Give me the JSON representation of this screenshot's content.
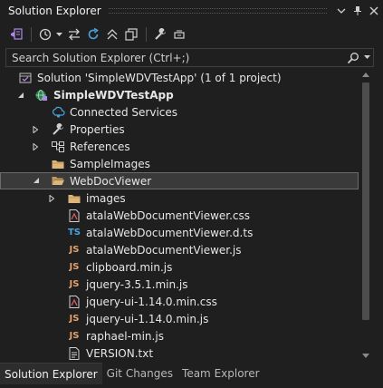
{
  "panel": {
    "title": "Solution Explorer"
  },
  "search": {
    "placeholder": "Search Solution Explorer (Ctrl+;)"
  },
  "tree": {
    "solution": "Solution 'SimpleWDVTestApp' (1 of 1 project)",
    "project": "SimpleWDVTestApp",
    "connected": "Connected Services",
    "properties": "Properties",
    "references": "References",
    "sampleimages": "SampleImages",
    "webdocviewer": "WebDocViewer",
    "images": "images",
    "f1": "atalaWebDocumentViewer.css",
    "f2": "atalaWebDocumentViewer.d.ts",
    "f3": "atalaWebDocumentViewer.js",
    "f4": "clipboard.min.js",
    "f5": "jquery-3.5.1.min.js",
    "f6": "jquery-ui-1.14.0.min.css",
    "f7": "jquery-ui-1.14.0.min.js",
    "f8": "raphael-min.js",
    "f9": "VERSION.txt"
  },
  "badges": {
    "ts": "TS",
    "js": "JS"
  },
  "tabs": [
    "Solution Explorer",
    "Git Changes",
    "Team Explorer"
  ],
  "colors": {
    "accent": "#0e639c",
    "folder": "#dcb67a",
    "js": "#e3a06a",
    "ts": "#4aa3df"
  }
}
